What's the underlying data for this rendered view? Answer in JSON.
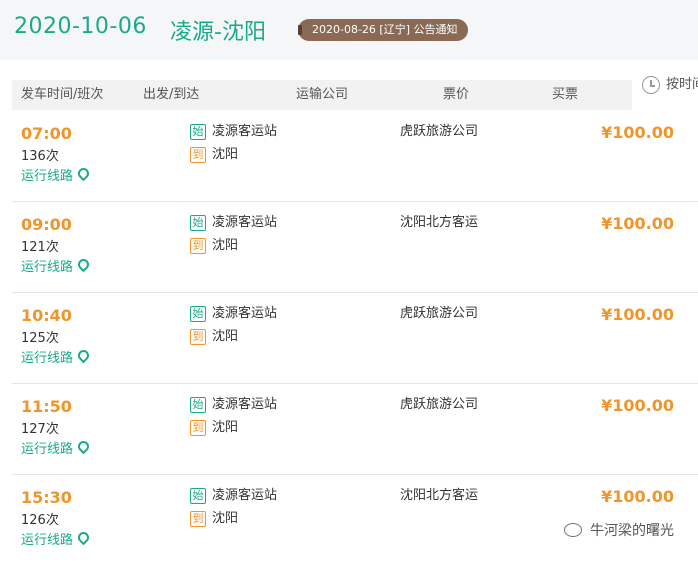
{
  "header": {
    "date": "2020-10-06",
    "route": "凌源-沈阳",
    "notice": "2020-08-26 [辽宁] 公告通知"
  },
  "table_header": {
    "col_time": "发车时间/班次",
    "col_route": "出发/到达",
    "col_company": "运输公司",
    "col_price": "票价",
    "col_buy": "买票",
    "sort_label": "按时间"
  },
  "labels": {
    "start_tag": "始",
    "end_tag": "到",
    "route_link": "运行线路"
  },
  "trips": [
    {
      "time": "07:00",
      "number": "136次",
      "from": "凌源客运站",
      "to": "沈阳",
      "company": "虎跃旅游公司",
      "price": "¥100.00"
    },
    {
      "time": "09:00",
      "number": "121次",
      "from": "凌源客运站",
      "to": "沈阳",
      "company": "沈阳北方客运",
      "price": "¥100.00"
    },
    {
      "time": "10:40",
      "number": "125次",
      "from": "凌源客运站",
      "to": "沈阳",
      "company": "虎跃旅游公司",
      "price": "¥100.00"
    },
    {
      "time": "11:50",
      "number": "127次",
      "from": "凌源客运站",
      "to": "沈阳",
      "company": "虎跃旅游公司",
      "price": "¥100.00"
    },
    {
      "time": "15:30",
      "number": "126次",
      "from": "凌源客运站",
      "to": "沈阳",
      "company": "沈阳北方客运",
      "price": "¥100.00"
    }
  ],
  "watermark": "牛河梁的曙光",
  "colors": {
    "accent": "#1aaa8a",
    "price": "#f0952a",
    "notice_bg": "#8a6a55"
  }
}
